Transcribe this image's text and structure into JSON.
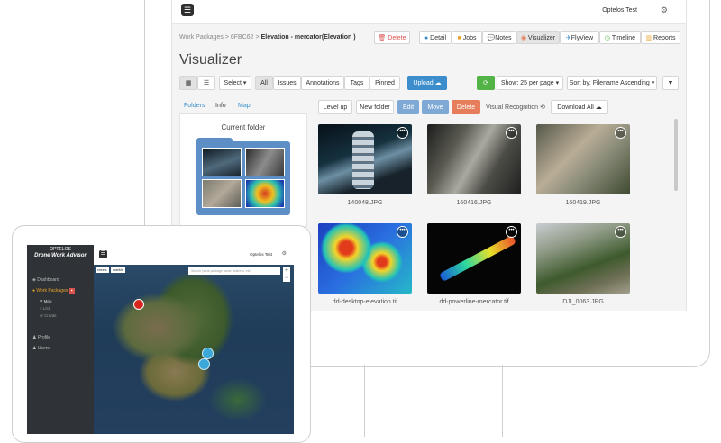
{
  "app": {
    "user": "Optelos Test"
  },
  "breadcrumb": {
    "root": "Work Packages",
    "id": "6FBC62",
    "current": "Elevation - mercator(Elevation )",
    "sep": ">"
  },
  "tabs_top": {
    "delete": "Delete",
    "detail": "Detail",
    "jobs": "Jobs",
    "notes": "Notes",
    "visualizer": "Visualizer",
    "flyview": "FlyView",
    "timeline": "Timeline",
    "reports": "Reports"
  },
  "page_title": "Visualizer",
  "toolbar": {
    "select": "Select ▾",
    "all": "All",
    "issues": "Issues",
    "annotations": "Annotations",
    "tags": "Tags",
    "pinned": "Pinned",
    "upload": "Upload",
    "show": "Show: 25 per page ▾",
    "sort": "Sort by: Filename Ascending ▾"
  },
  "side_tabs": {
    "folders": "Folders",
    "info": "Info",
    "map": "Map"
  },
  "actions": {
    "level_up": "Level up",
    "new_folder": "New folder",
    "edit": "Edit",
    "move": "Move",
    "delete": "Delete",
    "visual_recognition": "Visual Recognition",
    "download_all": "Download All"
  },
  "panel": {
    "title": "Current folder"
  },
  "files": [
    {
      "name": "140048.JPG"
    },
    {
      "name": "160416.JPG"
    },
    {
      "name": "160419.JPG"
    },
    {
      "name": "dd-desktop-elevation.tif"
    },
    {
      "name": "dd-powerline-mercator.tif"
    },
    {
      "name": "DJI_0063.JPG"
    }
  ],
  "tablet": {
    "logo": "OPTELOS",
    "app_name": "Drone Work Advisor",
    "user": "Optelos Test",
    "nav": {
      "dashboard": "Dashboard",
      "work_packages": "Work Packages",
      "profile": "Profile",
      "users": "Users"
    },
    "sub": {
      "map": "Map",
      "list": "List",
      "create": "Create"
    },
    "search_placeholder": "Search (work package name, address, etc)",
    "map_btn1": "streets",
    "map_btn2": "satellite"
  },
  "colors": {
    "accent_blue": "#3c8dcb",
    "green": "#52b447",
    "orange": "#e67e5c",
    "wp_orange": "#e8a32a"
  }
}
